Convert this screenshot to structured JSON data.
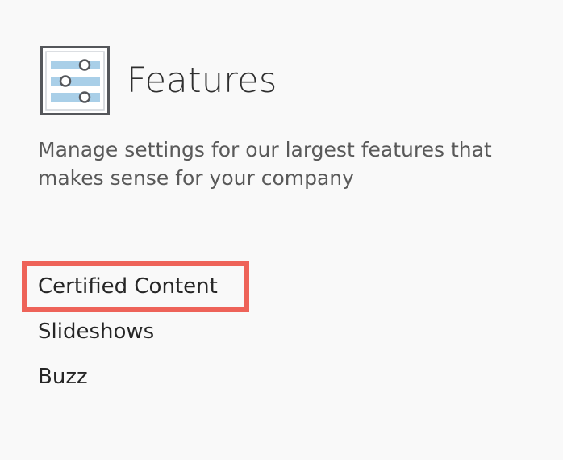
{
  "header": {
    "title": "Features",
    "icon": "sliders-icon"
  },
  "description": "Manage settings for our largest features that makes sense for your company",
  "features": [
    {
      "label": "Certified Content",
      "highlighted": true
    },
    {
      "label": "Slideshows",
      "highlighted": false
    },
    {
      "label": "Buzz",
      "highlighted": false
    }
  ],
  "colors": {
    "background": "#f9f9f9",
    "icon_frame": "#55575b",
    "icon_bars": "#a9cfe8",
    "highlight": "#ee6359"
  }
}
